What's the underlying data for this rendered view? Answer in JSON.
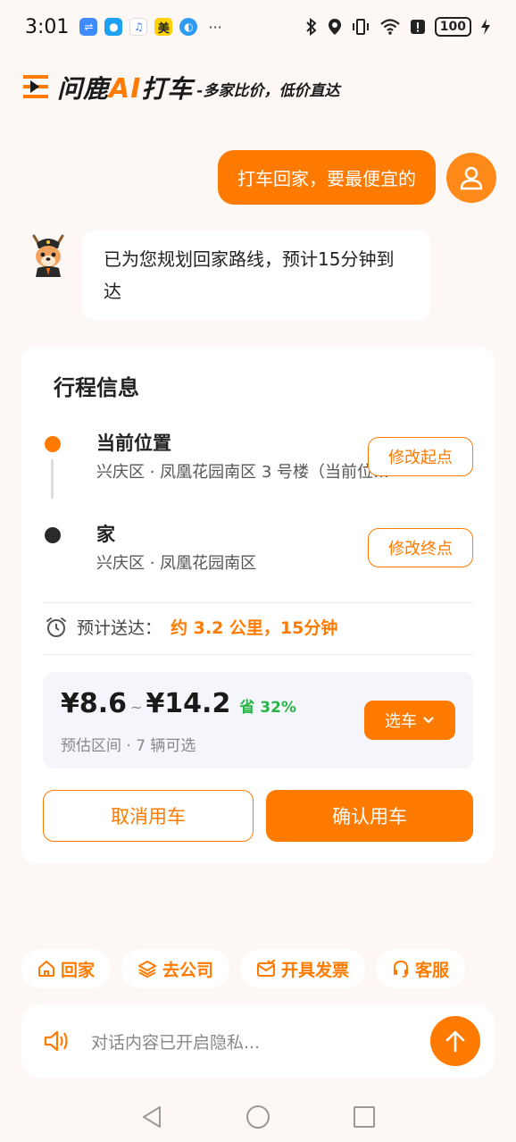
{
  "status_bar": {
    "time": "3:01",
    "notification_icons": [
      "usb-icon",
      "message-icon",
      "music-icon",
      "meituan-icon",
      "blue-app-icon"
    ],
    "more": "···",
    "battery": "100"
  },
  "header": {
    "brand_text": "问鹿",
    "brand_ai": "AI",
    "brand_suffix": "打车",
    "slogan": "-多家比价，低价直达"
  },
  "chat": {
    "user_message": "打车回家，要最便宜的",
    "bot_message": "已为您规划回家路线，预计15分钟到达"
  },
  "trip": {
    "title": "行程信息",
    "start": {
      "name": "当前位置",
      "address": "兴庆区 · 凤凰花园南区 3 号楼（当前位置）",
      "button": "修改起点"
    },
    "end": {
      "name": "家",
      "address": "兴庆区 · 凤凰花园南区",
      "button": "修改终点"
    },
    "eta_label": "预计送达：",
    "eta_value": "约 3.2 公里，15分钟",
    "price_low": "¥8.6",
    "price_sep": "~",
    "price_high": "¥14.2",
    "saving": "省 32%",
    "price_sub": "预估区间 · 7 辆可选",
    "select_car": "选车",
    "cancel": "取消用车",
    "confirm": "确认用车"
  },
  "quick_actions": [
    {
      "label": "回家",
      "icon": "home-icon"
    },
    {
      "label": "去公司",
      "icon": "layers-icon"
    },
    {
      "label": "开具发票",
      "icon": "invoice-icon"
    },
    {
      "label": "客服",
      "icon": "headset-icon"
    }
  ],
  "input": {
    "placeholder": "对话内容已开启隐私..."
  },
  "colors": {
    "accent": "#ff7a00",
    "saving": "#28b446",
    "background": "#fdf8f5"
  }
}
